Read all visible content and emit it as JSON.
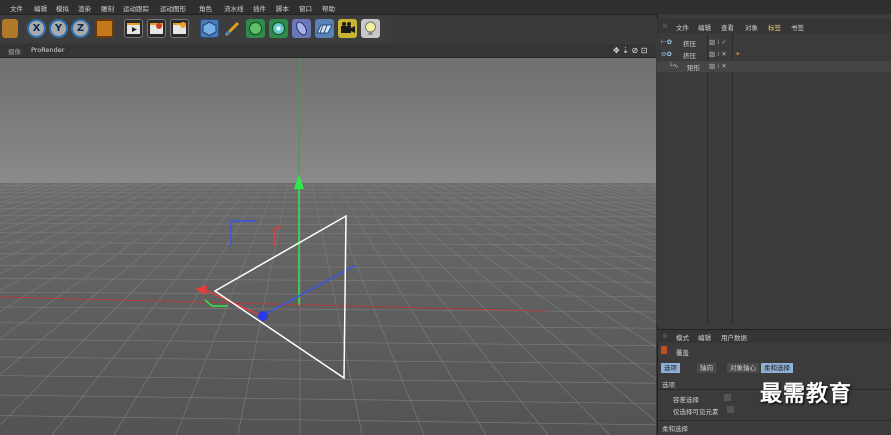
{
  "menu": [
    "文件",
    "编辑",
    "模拟",
    "渲染",
    "雕刻",
    "运动跟踪",
    "运动图形",
    "角色",
    "流水线",
    "插件",
    "脚本",
    "窗口",
    "帮助"
  ],
  "toolbar": {
    "axis_x": "X",
    "axis_y": "Y",
    "axis_z": "Z",
    "icons": [
      "render-view-icon",
      "render-settings-icon",
      "picture-viewer-icon",
      "cube-icon",
      "pen-icon",
      "subdivision-icon",
      "generator-icon",
      "deformer-icon",
      "floor-icon",
      "camera-icon",
      "light-icon"
    ]
  },
  "viewport": {
    "menu_first": "摄像",
    "renderer": "ProRender",
    "nav_icons": "✥ ⇣ ⊘ ⊡"
  },
  "objects_panel": {
    "menu": [
      "文件",
      "编辑",
      "查看",
      "对象",
      "标签",
      "书签"
    ],
    "items": [
      {
        "name": "挤压",
        "color": "#d8b24a"
      },
      {
        "name": "挤压",
        "color": "#9fd0f0"
      },
      {
        "name": "矩形",
        "color": "#cfcfcf"
      }
    ]
  },
  "attributes_panel": {
    "menu": [
      "模式",
      "编辑",
      "用户数据"
    ],
    "title": "覆盖",
    "tabs": [
      "选项",
      "轴向",
      "对象轴心",
      "柔和选择"
    ],
    "section": "选项",
    "fields": [
      {
        "label": "容差选择",
        "value": ""
      },
      {
        "label": "仅选择可见元素",
        "value": ""
      }
    ],
    "bottom_section": "柔和选择"
  },
  "watermark": "最需教育",
  "colors": {
    "active_tab": "#8fb0d6",
    "accent_blue": "#2c6fb0"
  }
}
